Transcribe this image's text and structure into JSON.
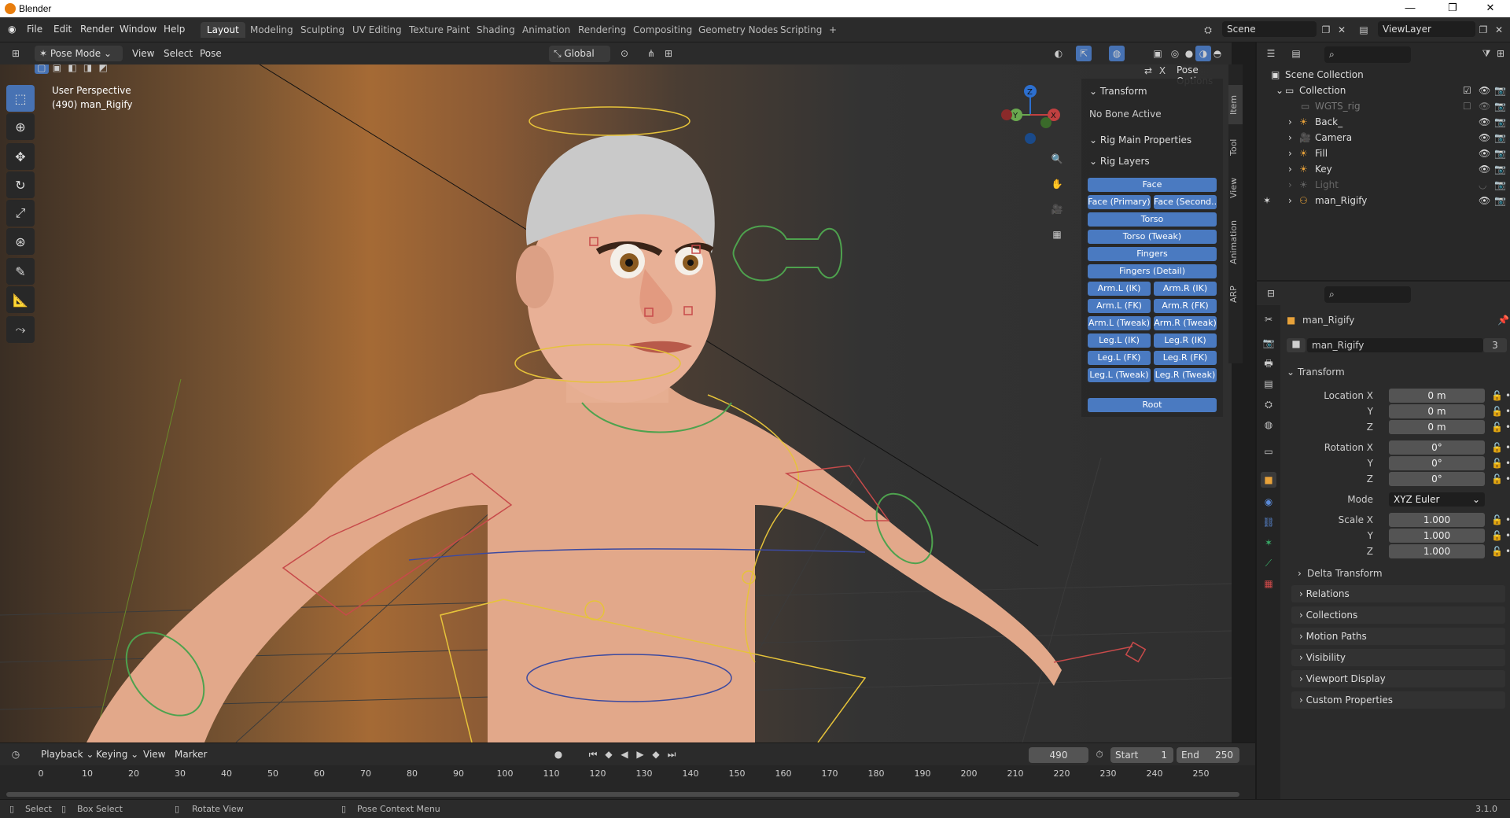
{
  "window": {
    "title": "Blender"
  },
  "menu": [
    "File",
    "Edit",
    "Render",
    "Window",
    "Help"
  ],
  "workspaces": [
    "Layout",
    "Modeling",
    "Sculpting",
    "UV Editing",
    "Texture Paint",
    "Shading",
    "Animation",
    "Rendering",
    "Compositing",
    "Geometry Nodes",
    "Scripting",
    "+"
  ],
  "scene": {
    "label": "Scene",
    "viewlayer": "ViewLayer"
  },
  "viewport_header": {
    "mode": "Pose Mode",
    "menus": [
      "View",
      "Select",
      "Pose"
    ],
    "orientation": "Global",
    "pose_options": "Pose Options"
  },
  "viewport": {
    "perspective": "User Perspective",
    "object": "(490) man_Rigify"
  },
  "npanel": {
    "tabs": [
      "Item",
      "Tool",
      "View",
      "Animation",
      "ARP"
    ],
    "transform_title": "Transform",
    "no_bone": "No Bone Active",
    "rig_main": "Rig Main Properties",
    "rig_layers": "Rig Layers",
    "buttons": {
      "face": "Face",
      "face_primary": "Face (Primary)",
      "face_second": "Face (Second...",
      "torso": "Torso",
      "torso_tweak": "Torso (Tweak)",
      "fingers": "Fingers",
      "fingers_detail": "Fingers (Detail)",
      "arm_l_ik": "Arm.L (IK)",
      "arm_r_ik": "Arm.R (IK)",
      "arm_l_fk": "Arm.L (FK)",
      "arm_r_fk": "Arm.R (FK)",
      "arm_l_tweak": "Arm.L (Tweak)",
      "arm_r_tweak": "Arm.R (Tweak)",
      "leg_l_ik": "Leg.L (IK)",
      "leg_r_ik": "Leg.R (IK)",
      "leg_l_fk": "Leg.L (FK)",
      "leg_r_fk": "Leg.R (FK)",
      "leg_l_tweak": "Leg.L (Tweak)",
      "leg_r_tweak": "Leg.R (Tweak)",
      "root": "Root"
    }
  },
  "outliner": {
    "scene_collection": "Scene Collection",
    "collection": "Collection",
    "items": [
      "WGTS_rig",
      "Back_",
      "Camera",
      "Fill",
      "Key",
      "Light",
      "man_Rigify"
    ]
  },
  "properties": {
    "object_name": "man_Rigify",
    "datablock": "man_Rigify",
    "users": "3",
    "transform": "Transform",
    "location_x_label": "Location X",
    "y_label": "Y",
    "z_label": "Z",
    "location": [
      "0 m",
      "0 m",
      "0 m"
    ],
    "rotation_x_label": "Rotation X",
    "rotation": [
      "0°",
      "0°",
      "0°"
    ],
    "mode_label": "Mode",
    "mode": "XYZ Euler",
    "scale_x_label": "Scale X",
    "scale": [
      "1.000",
      "1.000",
      "1.000"
    ],
    "delta": "Delta Transform",
    "sections": [
      "Relations",
      "Collections",
      "Motion Paths",
      "Visibility",
      "Viewport Display",
      "Custom Properties"
    ]
  },
  "timeline": {
    "menus": [
      "Playback",
      "Keying",
      "View",
      "Marker"
    ],
    "current_frame": "490",
    "start_label": "Start",
    "start": "1",
    "end_label": "End",
    "end": "250",
    "ticks": [
      "0",
      "10",
      "20",
      "30",
      "40",
      "50",
      "60",
      "70",
      "80",
      "90",
      "100",
      "110",
      "120",
      "130",
      "140",
      "150",
      "160",
      "170",
      "180",
      "190",
      "200",
      "210",
      "220",
      "230",
      "240",
      "250"
    ]
  },
  "status": {
    "select": "Select",
    "box_select": "Box Select",
    "rotate": "Rotate View",
    "context": "Pose Context Menu",
    "version": "3.1.0"
  },
  "colors": {
    "accent": "#4a7ac1",
    "active_tool": "#4772b3"
  }
}
